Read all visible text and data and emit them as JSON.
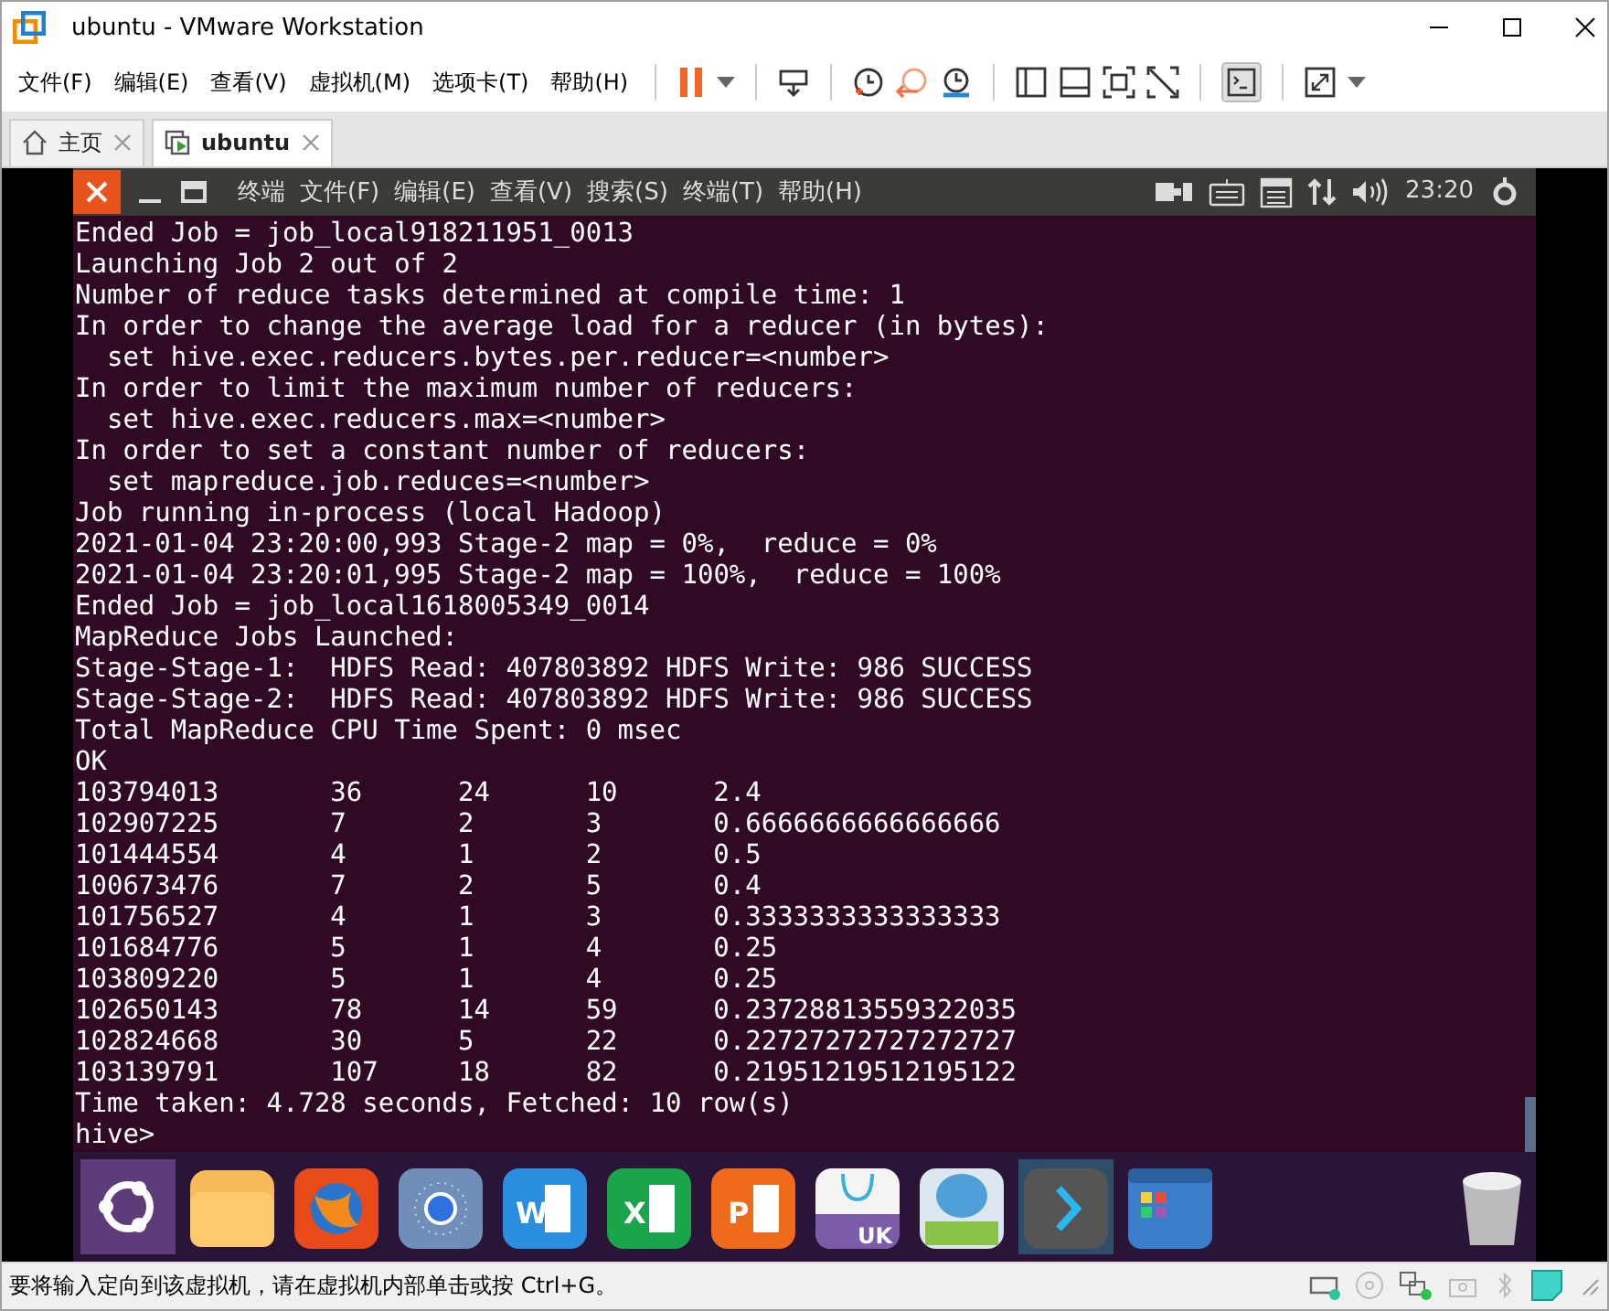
{
  "window": {
    "title": "ubuntu - VMware Workstation"
  },
  "menu": [
    "文件(F)",
    "编辑(E)",
    "查看(V)",
    "虚拟机(M)",
    "选项卡(T)",
    "帮助(H)"
  ],
  "tabs": [
    {
      "label": "主页",
      "selected": false
    },
    {
      "label": "ubuntu",
      "selected": true
    }
  ],
  "guest_panel": {
    "app": "终端",
    "menu": [
      "文件(F)",
      "编辑(E)",
      "查看(V)",
      "搜索(S)",
      "终端(T)",
      "帮助(H)"
    ],
    "time": "23:20"
  },
  "terminal": {
    "lines": [
      "Ended Job = job_local918211951_0013",
      "Launching Job 2 out of 2",
      "Number of reduce tasks determined at compile time: 1",
      "In order to change the average load for a reducer (in bytes):",
      "  set hive.exec.reducers.bytes.per.reducer=<number>",
      "In order to limit the maximum number of reducers:",
      "  set hive.exec.reducers.max=<number>",
      "In order to set a constant number of reducers:",
      "  set mapreduce.job.reduces=<number>",
      "Job running in-process (local Hadoop)",
      "2021-01-04 23:20:00,993 Stage-2 map = 0%,  reduce = 0%",
      "2021-01-04 23:20:01,995 Stage-2 map = 100%,  reduce = 100%",
      "Ended Job = job_local1618005349_0014",
      "MapReduce Jobs Launched:",
      "Stage-Stage-1:  HDFS Read: 407803892 HDFS Write: 986 SUCCESS",
      "Stage-Stage-2:  HDFS Read: 407803892 HDFS Write: 986 SUCCESS",
      "Total MapReduce CPU Time Spent: 0 msec",
      "OK"
    ],
    "rows": [
      [
        "103794013",
        "36",
        "24",
        "10",
        "2.4"
      ],
      [
        "102907225",
        "7",
        "2",
        "3",
        "0.6666666666666666"
      ],
      [
        "101444554",
        "4",
        "1",
        "2",
        "0.5"
      ],
      [
        "100673476",
        "7",
        "2",
        "5",
        "0.4"
      ],
      [
        "101756527",
        "4",
        "1",
        "3",
        "0.3333333333333333"
      ],
      [
        "101684776",
        "5",
        "1",
        "4",
        "0.25"
      ],
      [
        "103809220",
        "5",
        "1",
        "4",
        "0.25"
      ],
      [
        "102650143",
        "78",
        "14",
        "59",
        "0.23728813559322035"
      ],
      [
        "102824668",
        "30",
        "5",
        "22",
        "0.22727272727272727"
      ],
      [
        "103139791",
        "107",
        "18",
        "82",
        "0.21951219512195122"
      ]
    ],
    "footer": "Time taken: 4.728 seconds, Fetched: 10 row(s)",
    "prompt": "hive>"
  },
  "dock": {
    "icon_labels": [
      "W",
      "X",
      "P",
      "UK"
    ]
  },
  "status_bar": {
    "message": "要将输入定向到该虚拟机，请在虚拟机内部单击或按 Ctrl+G。"
  }
}
